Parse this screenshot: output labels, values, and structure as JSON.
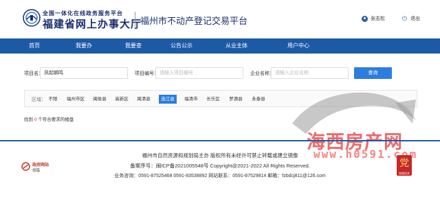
{
  "header": {
    "portal_top": "全国一体化在线政务服务平台",
    "portal_main": "福建省网上办事大厅",
    "platform_title": "福州市不动产登记交易平台",
    "user_name": "张志松",
    "logout_label": "退出"
  },
  "nav": {
    "items": [
      "首页",
      "我要办",
      "我要查",
      "公告公示",
      "从业主体",
      "用户中心"
    ]
  },
  "search": {
    "project_label": "项目名：",
    "project_value": "凤起朝鸣",
    "number_label": "项目编号：",
    "number_placeholder": "请输入项目编号",
    "company_label": "企业名称：",
    "company_placeholder": "请输入企业名称",
    "query_button": "查询"
  },
  "district": {
    "label": "区域：",
    "options": [
      "不限",
      "福州市区",
      "闽侯县",
      "高新区",
      "闽清县",
      "连江县",
      "福清市",
      "长乐区",
      "罗源县",
      "永泰县"
    ],
    "selected": "连江县"
  },
  "result": {
    "prefix": "找到",
    "count": "0",
    "suffix": "个符合要求的楼盘"
  },
  "footer": {
    "line1": "福州市自然资源和规划局主办 版权所有未经许可禁止转载或建立镜像",
    "line2": "备案序号：闽ICP备2021005548号 Copyright@2021-2022 All Rights Reserved.",
    "line3": "业务咨询：0591-87525468 0591-83538892 网站联系：0591-87529814 邮箱：fzbdcj811@126.com",
    "gov_site_title": "政府网站",
    "gov_site_sub": "找错",
    "badge_char": "党",
    "badge_sub": "党政机关"
  },
  "watermark": {
    "text_cn": "海西房产网",
    "text_url": "www.h0591.com"
  },
  "colors": {
    "nav_bg": "#1c5aa6",
    "accent": "#2c7de0",
    "brand": "#1a2f6e",
    "result_count": "#e02020",
    "watermark": "#e8514f"
  },
  "icons": [
    "emblem-icon",
    "user-icon",
    "logout-icon",
    "gov-site-icon",
    "party-badge-icon"
  ]
}
